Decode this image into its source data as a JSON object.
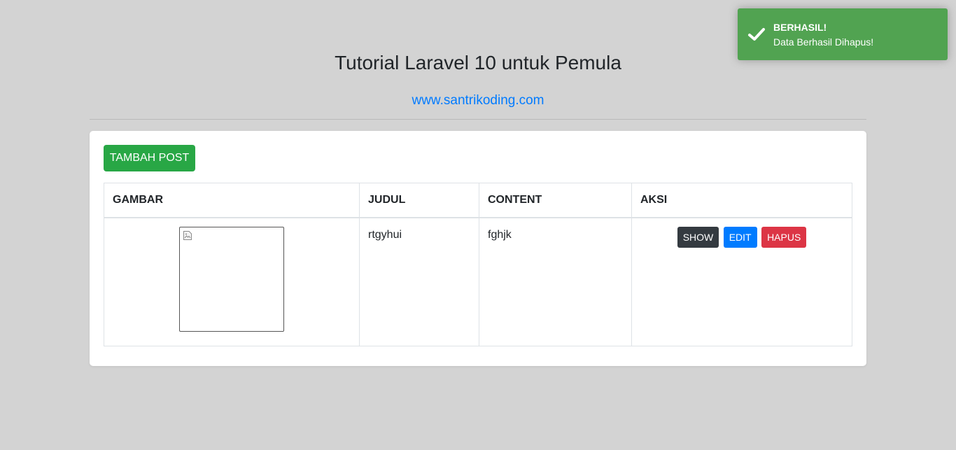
{
  "header": {
    "title": "Tutorial Laravel 10 untuk Pemula",
    "link_text": "www.santrikoding.com"
  },
  "card": {
    "add_button": "TAMBAH POST",
    "table": {
      "columns": [
        "GAMBAR",
        "JUDUL",
        "CONTENT",
        "AKSI"
      ],
      "rows": [
        {
          "judul": "rtgyhui",
          "content": "fghjk",
          "actions": {
            "show": "SHOW",
            "edit": "EDIT",
            "hapus": "HAPUS"
          }
        }
      ]
    }
  },
  "toast": {
    "title": "BERHASIL!",
    "message": "Data Berhasil Dihapus!",
    "icon": "check-icon"
  },
  "colors": {
    "background": "#d3d3d3",
    "primary": "#007bff",
    "success": "#28a745",
    "danger": "#dc3545",
    "dark": "#343a40",
    "toast": "#51a351"
  }
}
